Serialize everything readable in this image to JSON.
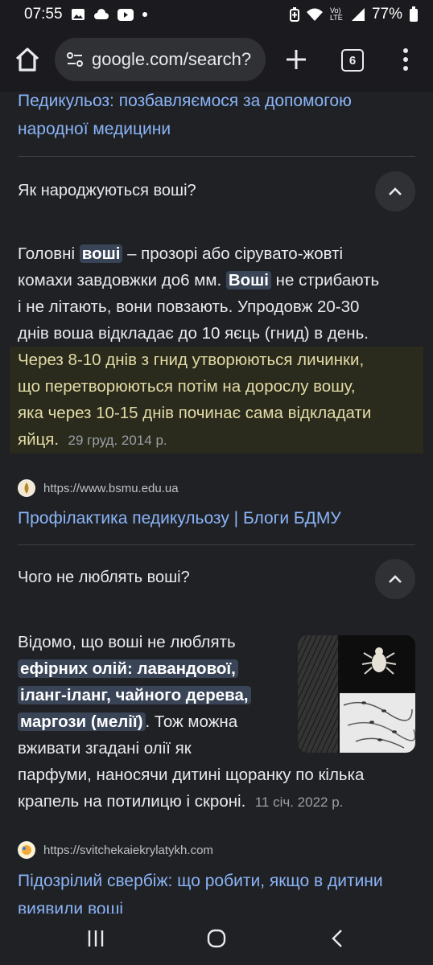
{
  "status_bar": {
    "time": "07:55",
    "battery": "77%",
    "icons": [
      "image-icon",
      "cloud-icon",
      "youtube-icon",
      "dot-icon",
      "battery-saver-icon",
      "wifi-icon",
      "volte-icon",
      "signal-icon",
      "battery-icon"
    ],
    "volte_label": "Vo) LTE"
  },
  "toolbar": {
    "url": "google.com/search?",
    "tab_count": "6"
  },
  "results": {
    "prev_link": {
      "line1": "Педикульоз: позбавляємося за допомогою",
      "line2": "народної медицини"
    },
    "faq1": {
      "question": "Як народжуються воші?",
      "p_line1_a": "Головні ",
      "p_line1_hl": "воші",
      "p_line1_b": " – прозорі або сірувато-жовті",
      "p_line2_a": "комахи завдовжки до6 мм. ",
      "p_line2_hl": "Воші",
      "p_line2_b": " не стрибають",
      "p_line3": "і не літають, вони повзають. Упродовж 20-30",
      "p_line4": "днів воша відкладає до 10 яєць (гнид) в день.",
      "p_line5": "Через 8-10 днів з гнид утворюються личинки,",
      "p_line6": "що перетворюються потім на дорослу вошу,",
      "p_line7": "яка через 10-15 днів починає сама відкладати",
      "p_line8": "яйця.",
      "date": "29 груд. 2014 р.",
      "source_url": "https://www.bsmu.edu.ua",
      "link_title": "Профілактика педикульозу | Блоги БДМУ"
    },
    "faq2": {
      "question": "Чого не люблять воші?",
      "p_line1": "Відомо, що воші не люблять",
      "p_line2_hl": "ефірних олій: лавандової,",
      "p_line3_hl": "іланг-іланг, чайного дерева,",
      "p_line4_hl": "маргози (мелії)",
      "p_line4_b": ". Тож можна",
      "p_line5": "вживати згадані олії як",
      "p_line6": "парфуми, наносячи дитині щоранку по кілька",
      "p_line7": "крапель на потилицю і скроні.",
      "date": "11 січ. 2022 р.",
      "source_url": "https://svitchekaiekrylatykh.com",
      "link_line1": "Підозрілий свербіж: що робити, якщо в дитини",
      "link_line2": "виявили воші"
    }
  },
  "nav_bar": {
    "icons": [
      "recent-apps-icon",
      "home-circle-icon",
      "back-icon"
    ]
  }
}
